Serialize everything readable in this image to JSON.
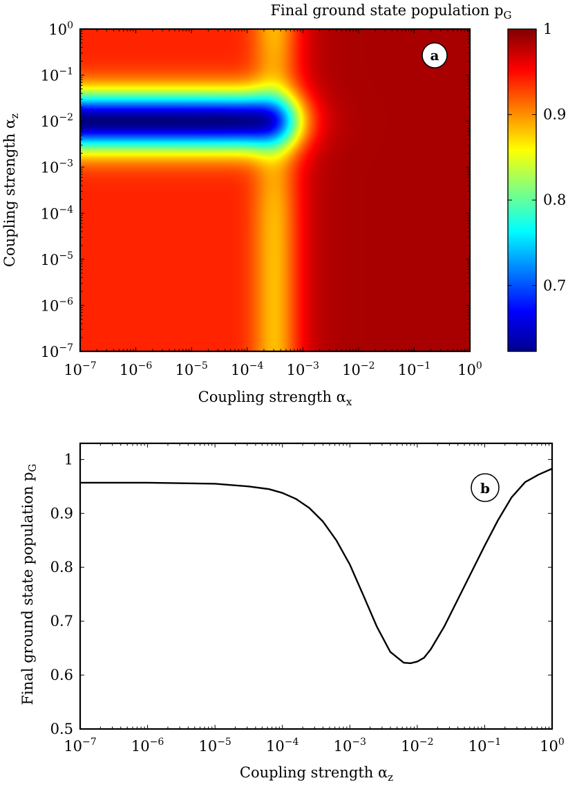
{
  "chart_data": [
    {
      "panel": "a",
      "type": "heatmap",
      "xlabel": "Coupling strength α",
      "xlabel_sub": "x",
      "ylabel": "Coupling strength α",
      "ylabel_sub": "z",
      "xscale": "log",
      "yscale": "log",
      "xlim": [
        1e-07,
        1
      ],
      "ylim": [
        1e-07,
        1
      ],
      "x_ticks": [
        {
          "base": "10",
          "exp": "−7"
        },
        {
          "base": "10",
          "exp": "−6"
        },
        {
          "base": "10",
          "exp": "−5"
        },
        {
          "base": "10",
          "exp": "−4"
        },
        {
          "base": "10",
          "exp": "−3"
        },
        {
          "base": "10",
          "exp": "−2"
        },
        {
          "base": "10",
          "exp": "−1"
        },
        {
          "base": "10",
          "exp": "0"
        }
      ],
      "y_ticks": [
        {
          "base": "10",
          "exp": "0"
        },
        {
          "base": "10",
          "exp": "−1"
        },
        {
          "base": "10",
          "exp": "−2"
        },
        {
          "base": "10",
          "exp": "−3"
        },
        {
          "base": "10",
          "exp": "−4"
        },
        {
          "base": "10",
          "exp": "−5"
        },
        {
          "base": "10",
          "exp": "−6"
        },
        {
          "base": "10",
          "exp": "−7"
        }
      ],
      "colorbar": {
        "label": "Final ground state population p",
        "label_sub": "G",
        "range": [
          0.623,
          1.0
        ],
        "ticks": [
          "1",
          "0.9",
          "0.8",
          "0.7"
        ],
        "tick_values": [
          1.0,
          0.9,
          0.8,
          0.7
        ],
        "colormap": "jet"
      },
      "field": {
        "background": 0.94,
        "x_transition_log10": -3.0,
        "right_region": 0.985,
        "transition_band_peak": 0.88,
        "transition_band_log10": -3.5,
        "dip_center_log10_z": -2.0,
        "dip_min": 0.623,
        "dip_extent_log10_x": -3.2
      },
      "annotation": "a"
    },
    {
      "panel": "b",
      "type": "line",
      "xlabel": "Coupling strength α",
      "xlabel_sub": "z",
      "ylabel": "Final ground state population p",
      "ylabel_sub": "G",
      "xscale": "log",
      "xlim": [
        1e-07,
        1
      ],
      "ylim": [
        0.5,
        1.03
      ],
      "x_ticks": [
        {
          "base": "10",
          "exp": "−7"
        },
        {
          "base": "10",
          "exp": "−6"
        },
        {
          "base": "10",
          "exp": "−5"
        },
        {
          "base": "10",
          "exp": "−4"
        },
        {
          "base": "10",
          "exp": "−3"
        },
        {
          "base": "10",
          "exp": "−2"
        },
        {
          "base": "10",
          "exp": "−1"
        },
        {
          "base": "10",
          "exp": "0"
        }
      ],
      "y_ticks": [
        "0.5",
        "0.6",
        "0.7",
        "0.8",
        "0.9",
        "1"
      ],
      "y_tick_values": [
        0.5,
        0.6,
        0.7,
        0.8,
        0.9,
        1.0
      ],
      "series": [
        {
          "log10_x": [
            -7,
            -6,
            -5,
            -4.5,
            -4.2,
            -4,
            -3.8,
            -3.6,
            -3.4,
            -3.2,
            -3,
            -2.8,
            -2.6,
            -2.4,
            -2.2,
            -2.1,
            -2,
            -1.9,
            -1.8,
            -1.6,
            -1.4,
            -1.2,
            -1,
            -0.8,
            -0.6,
            -0.4,
            -0.2,
            0
          ],
          "y": [
            0.957,
            0.957,
            0.955,
            0.95,
            0.945,
            0.938,
            0.927,
            0.91,
            0.885,
            0.85,
            0.805,
            0.748,
            0.69,
            0.643,
            0.623,
            0.622,
            0.625,
            0.632,
            0.648,
            0.69,
            0.74,
            0.79,
            0.84,
            0.888,
            0.93,
            0.958,
            0.972,
            0.983
          ]
        }
      ],
      "annotation": "b"
    }
  ]
}
